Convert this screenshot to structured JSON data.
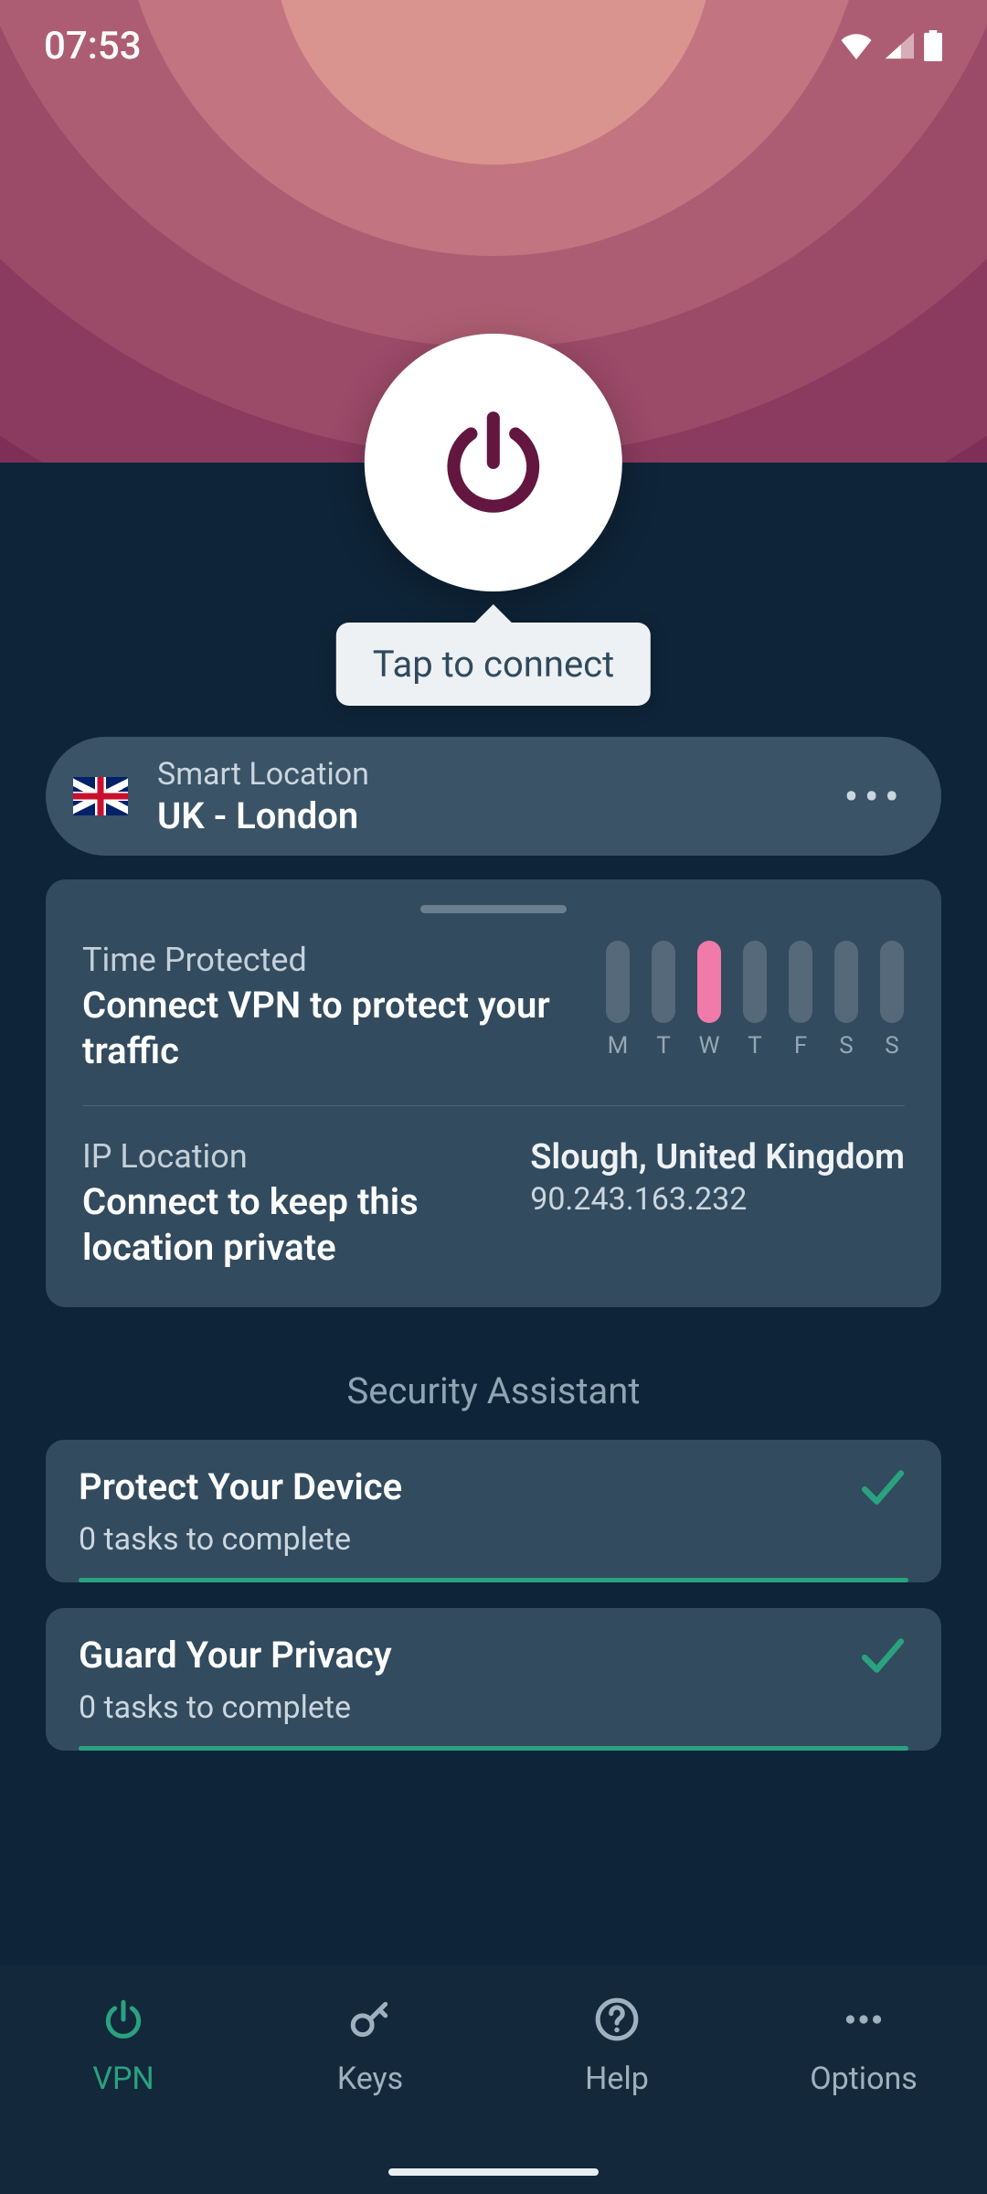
{
  "status": {
    "time": "07:53"
  },
  "connect": {
    "tooltip": "Tap to connect"
  },
  "location": {
    "smart": "Smart Location",
    "name": "UK - London"
  },
  "stats": {
    "time_label": "Time Protected",
    "time_value": "Connect VPN to protect your traffic",
    "days": [
      "M",
      "T",
      "W",
      "T",
      "F",
      "S",
      "S"
    ],
    "active_day_index": 2,
    "ip_label": "IP Location",
    "ip_value": "Connect to keep this location private",
    "ip_location": "Slough, United Kingdom",
    "ip_address": "90.243.163.232"
  },
  "security": {
    "title": "Security Assistant",
    "tasks": [
      {
        "title": "Protect Your Device",
        "sub": "0 tasks to complete",
        "done": true
      },
      {
        "title": "Guard Your Privacy",
        "sub": "0 tasks to complete",
        "done": true
      }
    ]
  },
  "nav": {
    "items": [
      {
        "label": "VPN",
        "icon": "power",
        "active": true
      },
      {
        "label": "Keys",
        "icon": "key",
        "active": false
      },
      {
        "label": "Help",
        "icon": "help",
        "active": false
      },
      {
        "label": "Options",
        "icon": "dots",
        "active": false
      }
    ]
  },
  "colors": {
    "accent": "#2aa27f",
    "power": "#63163f",
    "card": "#324b5e"
  }
}
